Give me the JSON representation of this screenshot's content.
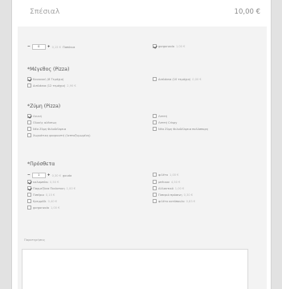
{
  "product": {
    "title": "Σπέσιαλ",
    "price": "10,00 €"
  },
  "top_options": [
    {
      "type": "stepper",
      "value": "0",
      "price": "0,15 €",
      "label": "Παπάκια"
    },
    {
      "type": "checkbox",
      "checked": true,
      "label": "gorgonzola",
      "price": "1,00 €"
    }
  ],
  "sections": [
    {
      "title": "*Μέγεθος (Pizza)",
      "options": [
        {
          "label": "Κανονική (8 Τεμάχια)",
          "price": "",
          "checked": true
        },
        {
          "label": "Διπλάσια (10 τεμάχια)",
          "price": "0,00 €",
          "checked": false
        },
        {
          "label": "Διπλάσια (12 τεμάχια)",
          "price": "2,90 €",
          "checked": false
        }
      ]
    },
    {
      "title": "*Ζύμη (Pizza)",
      "options": [
        {
          "label": "Λευκή",
          "price": "",
          "checked": true
        },
        {
          "label": "Λεπτή",
          "price": "",
          "checked": false
        },
        {
          "label": "Ολικής αλέσεως",
          "price": "",
          "checked": false
        },
        {
          "label": "Λεπτή Crispy",
          "price": "",
          "checked": false
        },
        {
          "label": "Νέα Ζύμη Φιλαδέλφεια",
          "price": "",
          "checked": false
        },
        {
          "label": "Νέα Ζύμη Φιλαδέλφεια πολύσπορη",
          "price": "",
          "checked": false
        },
        {
          "label": "Χωριάτικη φουρνιστή (λεπτοζυμωμένη)",
          "price": "",
          "checked": false
        }
      ]
    },
    {
      "title": "*Πρόσθετα",
      "options": [
        {
          "type": "stepper",
          "value": "1",
          "price": "0,30 €",
          "label": "gouda"
        },
        {
          "label": "φιλέτο",
          "price": "1,00 €",
          "checked": false
        },
        {
          "label": "καλαμπόκι",
          "price": "0,50 €",
          "checked": true
        },
        {
          "label": "μπέικον",
          "price": "4,50 €",
          "checked": false
        },
        {
          "label": "Παρμεζάνα Πικάντικη",
          "price": "1,00 €",
          "checked": true
        },
        {
          "label": "Αλλαντικό",
          "price": "1,00 €",
          "checked": false
        },
        {
          "label": "Πιπέρια",
          "price": "0,15 €",
          "checked": false
        },
        {
          "label": "Πιπεριά πράσινη",
          "price": "0,30 €",
          "checked": false
        },
        {
          "label": "Κρεμμύδι",
          "price": "0,40 €",
          "checked": false
        },
        {
          "label": "φιλέτο κοτόπουλο",
          "price": "0,83 €",
          "checked": false
        },
        {
          "label": "gorgonzola",
          "price": "1,00 €",
          "checked": false
        }
      ]
    }
  ],
  "notes": {
    "label": "Παρατηρήσεις",
    "value": ""
  }
}
